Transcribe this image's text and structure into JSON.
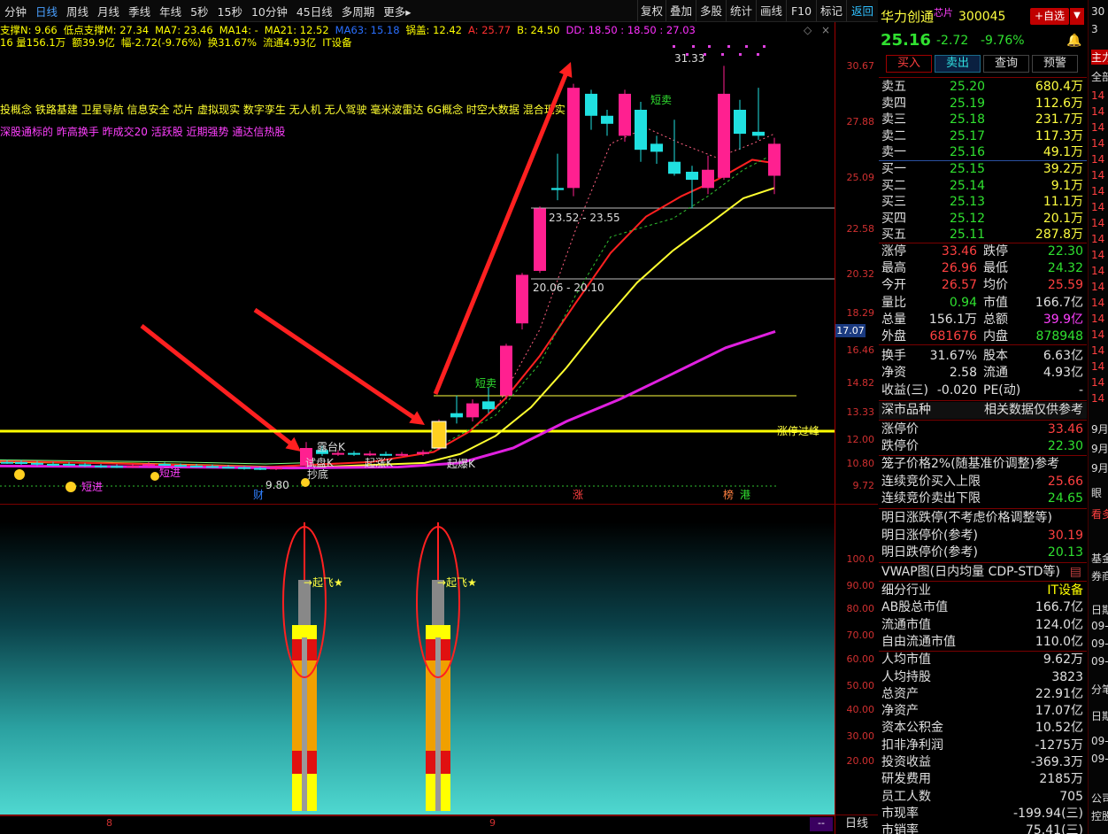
{
  "toolbar": {
    "periods": [
      "分钟",
      "日线",
      "周线",
      "月线",
      "季线",
      "年线",
      "5秒",
      "15秒",
      "10分钟",
      "45日线",
      "多周期",
      "更多▸"
    ],
    "active_period": "日线",
    "tools": [
      "复权",
      "叠加",
      "多股",
      "统计",
      "画线",
      "F10",
      "标记",
      "返回"
    ]
  },
  "indicators": {
    "row1": [
      {
        "t": "支撑N: 9.66",
        "c": "#ffff00"
      },
      {
        "t": "低点支撑M: 27.34",
        "c": "#ffff00"
      },
      {
        "t": "MA7: 23.46",
        "c": "#ffff00"
      },
      {
        "t": "MA14: -",
        "c": "#ffff00"
      },
      {
        "t": "MA21: 12.52",
        "c": "#ffff00"
      },
      {
        "t": "MA63: 15.18",
        "c": "#2a6fff"
      },
      {
        "t": "锅盖: 12.42",
        "c": "#ffff00"
      },
      {
        "t": "A: 25.77",
        "c": "#ff3030"
      },
      {
        "t": "B: 24.50",
        "c": "#ffff00"
      },
      {
        "t": "DD: 18.50 : 18.50 : 27.03",
        "c": "#ff30ff"
      }
    ],
    "row2": [
      {
        "t": "16 量156.1万",
        "c": "#ffff00"
      },
      {
        "t": "额39.9亿",
        "c": "#ffff00"
      },
      {
        "t": "幅-2.72(-9.76%)",
        "c": "#ffff00"
      },
      {
        "t": "换31.67%",
        "c": "#ffff00"
      },
      {
        "t": "流通4.93亿",
        "c": "#ffff00"
      },
      {
        "t": "IT设备",
        "c": "#ffff00"
      }
    ],
    "concepts": "投概念 铁路基建 卫星导航 信息安全 芯片 虚拟现实 数字孪生 无人机 无人驾驶 毫米波雷达 6G概念 时空大数据 混合现实",
    "concepts2": "深股通标的 昨高换手 昨成交20 活跃股 近期强势 通达信热股"
  },
  "chart_data": {
    "type": "candlestick",
    "y_axis_ticks": [
      "30.67",
      "27.88",
      "25.09",
      "22.58",
      "20.32",
      "18.29",
      "16.46",
      "14.82",
      "13.33",
      "12.00",
      "10.80",
      "9.72"
    ],
    "current_price_tag": "17.07",
    "annotations": [
      "31.33",
      "短卖",
      "短卖",
      "23.52 - 23.55",
      "20.06 - 20.10",
      "9.80",
      "露台K",
      "试盘K",
      "起涨K",
      "起爆K",
      "抄底",
      "短进",
      "短进",
      "涨停过峰"
    ],
    "event_tags": [
      "财",
      "涨",
      "榜",
      "港"
    ],
    "sub_chart_ticks": [
      "100.0",
      "90.00",
      "80.00",
      "70.00",
      "60.00",
      "50.00",
      "40.00",
      "30.00",
      "20.00"
    ],
    "sub_chart_labels": [
      "起飞★",
      "起飞★"
    ],
    "time_labels": [
      "8",
      "9"
    ],
    "period_label": "日线"
  },
  "stock": {
    "name": "华力创通",
    "tag": "芯片",
    "code": "300045",
    "self_select": "+自选",
    "price": "25.16",
    "change": "-2.72",
    "pct": "-9.76%",
    "actions": [
      "买入",
      "卖出",
      "查询",
      "预警"
    ]
  },
  "order_book": {
    "sells": [
      {
        "label": "卖五",
        "price": "25.20",
        "vol": "680.4万"
      },
      {
        "label": "卖四",
        "price": "25.19",
        "vol": "112.6万"
      },
      {
        "label": "卖三",
        "price": "25.18",
        "vol": "231.7万"
      },
      {
        "label": "卖二",
        "price": "25.17",
        "vol": "117.3万"
      },
      {
        "label": "卖一",
        "price": "25.16",
        "vol": "49.1万"
      }
    ],
    "buys": [
      {
        "label": "买一",
        "price": "25.15",
        "vol": "39.2万"
      },
      {
        "label": "买二",
        "price": "25.14",
        "vol": "9.1万"
      },
      {
        "label": "买三",
        "price": "25.13",
        "vol": "11.1万"
      },
      {
        "label": "买四",
        "price": "25.12",
        "vol": "20.1万"
      },
      {
        "label": "买五",
        "price": "25.11",
        "vol": "287.8万"
      }
    ]
  },
  "stats": [
    {
      "l1": "涨停",
      "v1": "33.46",
      "c1": "#ff4040",
      "l2": "跌停",
      "v2": "22.30",
      "c2": "#30e030"
    },
    {
      "l1": "最高",
      "v1": "26.96",
      "c1": "#ff4040",
      "l2": "最低",
      "v2": "24.32",
      "c2": "#30e030"
    },
    {
      "l1": "今开",
      "v1": "26.57",
      "c1": "#ff4040",
      "l2": "均价",
      "v2": "25.59",
      "c2": "#ff4040"
    },
    {
      "l1": "量比",
      "v1": "0.94",
      "c1": "#30e030",
      "l2": "市值",
      "v2": "166.7亿",
      "c2": "#e0e0e0"
    },
    {
      "l1": "总量",
      "v1": "156.1万",
      "c1": "#e0e0e0",
      "l2": "总额",
      "v2": "39.9亿",
      "c2": "#ff40ff"
    },
    {
      "l1": "外盘",
      "v1": "681676",
      "c1": "#ff4040",
      "l2": "内盘",
      "v2": "878948",
      "c2": "#30e030"
    },
    {
      "l1": "换手",
      "v1": "31.67%",
      "c1": "#e0e0e0",
      "l2": "股本",
      "v2": "6.63亿",
      "c2": "#e0e0e0"
    },
    {
      "l1": "净资",
      "v1": "2.58",
      "c1": "#e0e0e0",
      "l2": "流通",
      "v2": "4.93亿",
      "c2": "#e0e0e0"
    },
    {
      "l1": "收益(三)",
      "v1": "-0.020",
      "c1": "#e0e0e0",
      "l2": "PE(动)",
      "v2": "-",
      "c2": "#e0e0e0"
    }
  ],
  "market_info": {
    "title": "深市品种",
    "note": "相关数据仅供参考"
  },
  "limits": [
    {
      "label": "涨停价",
      "value": "33.46",
      "c": "#ff4040"
    },
    {
      "label": "跌停价",
      "value": "22.30",
      "c": "#30e030"
    }
  ],
  "cage": {
    "title": "笼子价格2%(随基准价调整)参考",
    "rows": [
      {
        "label": "连续竞价买入上限",
        "value": "25.66",
        "c": "#ff4040"
      },
      {
        "label": "连续竞价卖出下限",
        "value": "24.65",
        "c": "#30e030"
      }
    ]
  },
  "tomorrow": {
    "title": "明日涨跌停(不考虑价格调整等)",
    "rows": [
      {
        "label": "明日涨停价(参考)",
        "value": "30.19",
        "c": "#ff4040"
      },
      {
        "label": "明日跌停价(参考)",
        "value": "20.13",
        "c": "#30e030"
      }
    ]
  },
  "vwap_title": "VWAP图(日内均量 CDP-STD等)",
  "fundamentals": [
    {
      "label": "细分行业",
      "value": "IT设备",
      "c": "#ffff00"
    },
    {
      "label": "AB股总市值",
      "value": "166.7亿",
      "c": "#e0e0e0"
    },
    {
      "label": "流通市值",
      "value": "124.0亿",
      "c": "#e0e0e0"
    },
    {
      "label": "自由流通市值",
      "value": "110.0亿",
      "c": "#e0e0e0"
    },
    {
      "label": "人均市值",
      "value": "9.62万",
      "c": "#e0e0e0"
    },
    {
      "label": "人均持股",
      "value": "3823",
      "c": "#e0e0e0"
    },
    {
      "label": "总资产",
      "value": "22.91亿",
      "c": "#e0e0e0"
    },
    {
      "label": "净资产",
      "value": "17.07亿",
      "c": "#e0e0e0"
    },
    {
      "label": "资本公积金",
      "value": "10.52亿",
      "c": "#e0e0e0"
    },
    {
      "label": "扣非净利润",
      "value": "-1275万",
      "c": "#e0e0e0"
    },
    {
      "label": "投资收益",
      "value": "-369.3万",
      "c": "#e0e0e0"
    },
    {
      "label": "研发费用",
      "value": "2185万",
      "c": "#e0e0e0"
    },
    {
      "label": "员工人数",
      "value": "705",
      "c": "#e0e0e0"
    },
    {
      "label": "市现率",
      "value": "-199.94(三)",
      "c": "#e0e0e0"
    },
    {
      "label": "市销率",
      "value": "75.41(三)",
      "c": "#e0e0e0"
    }
  ],
  "far_right": [
    "30",
    "3",
    "主力",
    "全部",
    "14",
    "14",
    "14",
    "14",
    "14",
    "14",
    "14",
    "14",
    "14",
    "14",
    "14",
    "14",
    "14",
    "14",
    "14",
    "14",
    "14",
    "14",
    "14",
    "14",
    "9月",
    "9月",
    "9月",
    "眼",
    "看多",
    "基金",
    "券商",
    "日期",
    "09-",
    "09-",
    "09-",
    "分笔",
    "日期",
    "09-",
    "09-",
    "公司",
    "控股"
  ]
}
